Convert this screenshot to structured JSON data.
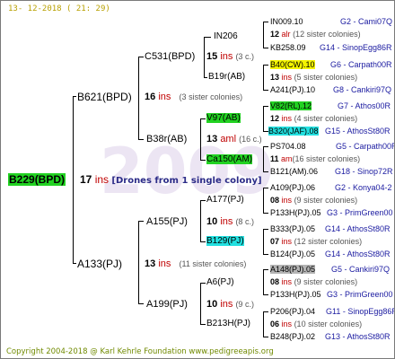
{
  "date": "13- 12-2018 ( 21: 29)",
  "copyright": "Copyright 2004-2018 @ Karl Kehrle Foundation   www.pedigreeapis.org",
  "watermark": "2009",
  "root": {
    "id": "B229(BPD)",
    "ins": "17",
    "ins_label": "ins",
    "note": "[Drones from 1 single colony]"
  },
  "sire": {
    "id": "B621(BPD)",
    "ins": "16",
    "ins_label": "ins",
    "sisters": "3",
    "sisters_label_pre": "(",
    "sisters_label_post": " sister colonies)"
  },
  "dam": {
    "id": "A133(PJ)",
    "ins": "13",
    "ins_label": "ins",
    "sisters": "11",
    "sisters_label_pre": "(",
    "sisters_label_post": " sister colonies)"
  },
  "g2": {
    "c531": {
      "id": "C531(BPD)",
      "ins": "15",
      "ins_label": "ins",
      "sis": "(3 c.)"
    },
    "b38r": {
      "id": "B38r(AB)",
      "ins": "13",
      "ins_label": "aml",
      "sis": "(16 c.)"
    },
    "a155": {
      "id": "A155(PJ)",
      "ins": "10",
      "ins_label": "ins",
      "sis": "(8 c.)"
    },
    "a199": {
      "id": "A199(PJ)",
      "ins": "10",
      "ins_label": "ins",
      "sis": "(9 c.)"
    }
  },
  "g3": {
    "in206": {
      "id": "IN206"
    },
    "b19r": {
      "id": "B19r(AB)"
    },
    "v97": {
      "id": "V97(AB)"
    },
    "ca150": {
      "id": "Ca150(AM)"
    },
    "a177": {
      "id": "A177(PJ)"
    },
    "b129": {
      "id": "B129(PJ)"
    },
    "a6": {
      "id": "A6(PJ)"
    },
    "b213h": {
      "id": "B213H(PJ)"
    }
  },
  "g4": {
    "r1": {
      "id": "IN009.10",
      "tail": "G2 - Cami07Q"
    },
    "r2": {
      "num": "12",
      "lab": "alr",
      "sis": "(12 sister colonies)"
    },
    "r3": {
      "id": "KB258.09",
      "tail": "G14 - SinopEgg86R"
    },
    "r4": {
      "id": "B40(CW).10",
      "tail": "G6 - Carpath00R"
    },
    "r5": {
      "num": "13",
      "lab": "ins",
      "sis": "(5 sister colonies)"
    },
    "r6": {
      "id": "A241(PJ).10",
      "tail": "G8 - Cankiri97Q"
    },
    "r7": {
      "id": "V82(RL).12",
      "tail": "G7 - Athos00R"
    },
    "r8": {
      "num": "12",
      "lab": "ins",
      "sis": "(4 sister colonies)"
    },
    "r9": {
      "id": "B320(JAF).08",
      "tail": "G15 - AthosSt80R"
    },
    "r10": {
      "id": "PS704.08",
      "tail": "G5 - Carpath00R"
    },
    "r11": {
      "num": "11",
      "lab": "am",
      "sis": "(16 sister colonies)"
    },
    "r12": {
      "id": "B121(AM).06",
      "tail": "G18 - Sinop72R"
    },
    "r13": {
      "id": "A109(PJ).06",
      "tail": "G2 - Konya04-2"
    },
    "r14": {
      "num": "08",
      "lab": "ins",
      "sis": "(9 sister colonies)"
    },
    "r15": {
      "id": "P133H(PJ).05",
      "tail": "G3 - PrimGreen00"
    },
    "r16": {
      "id": "B333(PJ).05",
      "tail": "G14 - AthosSt80R"
    },
    "r17": {
      "num": "07",
      "lab": "ins",
      "sis": "(12 sister colonies)"
    },
    "r18": {
      "id": "B124(PJ).05",
      "tail": "G14 - AthosSt80R"
    },
    "r19": {
      "id": "A148(PJ).05",
      "tail": "G5 - Cankiri97Q"
    },
    "r20": {
      "num": "08",
      "lab": "ins",
      "sis": "(9 sister colonies)"
    },
    "r21": {
      "id": "P133H(PJ).05",
      "tail": "G3 - PrimGreen00"
    },
    "r22": {
      "id": "P206(PJ).04",
      "tail": "G11 - SinopEgg86R"
    },
    "r23": {
      "num": "06",
      "lab": "ins",
      "sis": "(10 sister colonies)"
    },
    "r24": {
      "id": "B248(PJ).02",
      "tail": "G13 - AthosSt80R"
    }
  }
}
